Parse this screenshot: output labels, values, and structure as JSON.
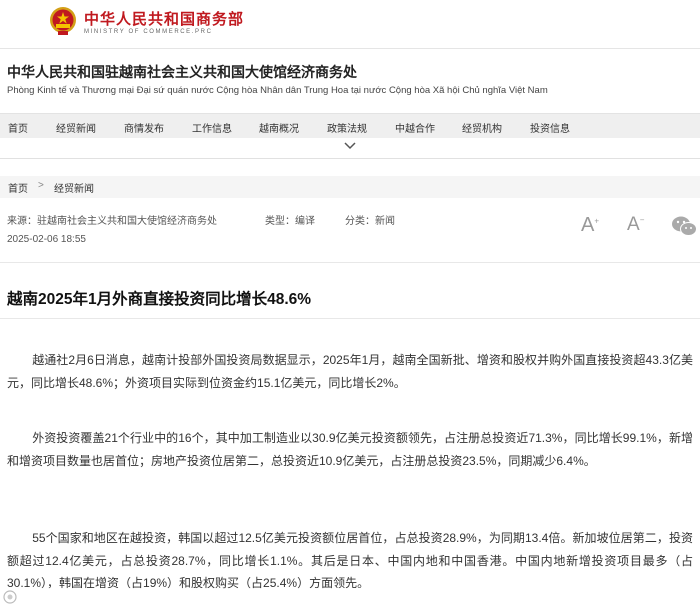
{
  "header": {
    "site_name_cn": "中华人民共和国商务部",
    "site_name_en": "MINISTRY OF COMMERCE.PRC",
    "emblem_icon": "national-emblem-icon",
    "brand_color": "#c0191f"
  },
  "office": {
    "title": "中华人民共和国驻越南社会主义共和国大使馆经济商务处",
    "subtitle": "Phòng Kinh tế và Thương mại Đại sứ quán nước Cộng hòa Nhân dân Trung Hoa tại nước Cộng hòa Xã hội Chủ nghĩa Việt Nam"
  },
  "nav": {
    "items": [
      "首页",
      "经贸新闻",
      "商情发布",
      "工作信息",
      "越南概况",
      "政策法规",
      "中越合作",
      "经贸机构",
      "投资信息"
    ],
    "expand_icon": "chevron-down-icon"
  },
  "breadcrumb": {
    "home": "首页",
    "separator": ">",
    "current": "经贸新闻"
  },
  "article": {
    "source": "来源：驻越南社会主义共和国大使馆经济商务处",
    "type": "类型：编译",
    "category": "分类：新闻",
    "date": "2025-02-06 18:55",
    "font_larger_label": "A",
    "font_smaller_label": "A",
    "share_icon": "wechat-icon",
    "title": "越南2025年1月外商直接投资同比增长48.6%",
    "paragraphs": [
      "越通社2月6日消息，越南计投部外国投资局数据显示，2025年1月，越南全国新批、增资和股权并购外国直接投资超43.3亿美元，同比增长48.6%；外资项目实际到位资金约15.1亿美元，同比增长2%。",
      "外资投资覆盖21个行业中的16个，其中加工制造业以30.9亿美元投资额领先，占注册总投资近71.3%，同比增长99.1%，新增和增资项目数量也居首位；房地产投资位居第二，总投资近10.9亿美元，占注册总投资23.5%，同期减少6.4%。",
      "55个国家和地区在越投资，韩国以超过12.5亿美元投资额位居首位，占总投资28.9%，为同期13.4倍。新加坡位居第二，投资额超过12.4亿美元，占总投资28.7%，同比增长1.1%。其后是日本、中国内地和中国香港。中国内地新增投资项目最多（占30.1%），韩国在增资（占19%）和股权购买（占25.4%）方面领先。"
    ]
  }
}
